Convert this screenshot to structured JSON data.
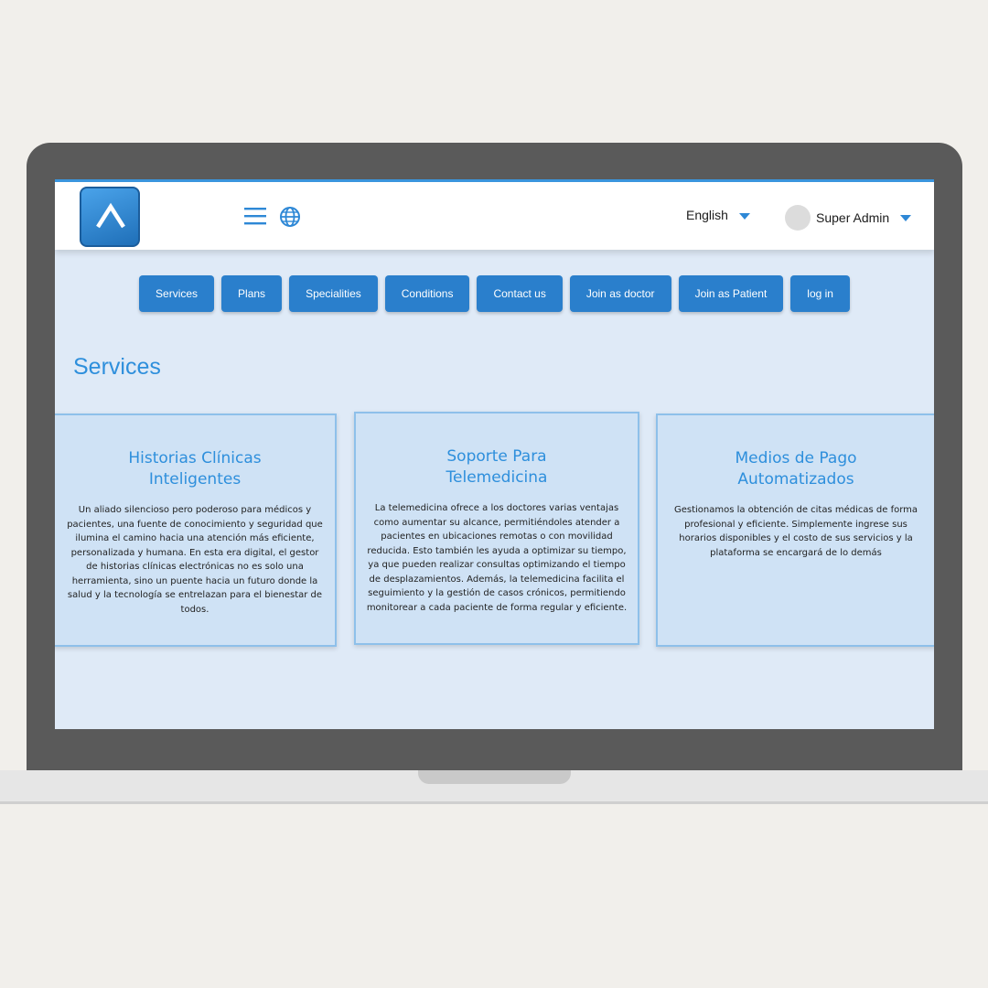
{
  "header": {
    "language": "English",
    "user": "Super Admin"
  },
  "nav": {
    "items": [
      "Services",
      "Plans",
      "Specialities",
      "Conditions",
      "Contact us",
      "Join as doctor",
      "Join as Patient",
      "log in"
    ]
  },
  "section_title": "Services",
  "cards": [
    {
      "title": "Historias Clínicas\nInteligentes",
      "body": "Un aliado silencioso pero poderoso para médicos y pacientes, una fuente de conocimiento y seguridad que ilumina el camino hacia una atención más eficiente, personalizada y humana. En esta era digital, el gestor de historias clínicas electrónicas no es solo una herramienta, sino un puente hacia un futuro donde la salud y la tecnología se entrelazan para el bienestar de todos."
    },
    {
      "title": "Soporte Para\nTelemedicina",
      "body": "La telemedicina ofrece a los doctores varias ventajas como aumentar su alcance, permitiéndoles atender a pacientes en ubicaciones remotas o con movilidad reducida. Esto también les ayuda a optimizar su tiempo, ya que pueden realizar consultas optimizando el tiempo de desplazamientos. Además, la telemedicina facilita el seguimiento y la gestión de casos crónicos, permitiendo monitorear a cada paciente de forma regular y eficiente."
    },
    {
      "title": "Medios de Pago\nAutomatizados",
      "body": "Gestionamos la obtención de citas médicas de forma profesional y eficiente. Simplemente ingrese sus horarios disponibles y el costo de sus servicios y la plataforma se encargará de lo demás"
    }
  ],
  "colors": {
    "accent": "#2e8fdc",
    "nav_button": "#2a7fcc",
    "card_bg": "#cfe2f5",
    "screen_bg": "#dfeaf7"
  }
}
